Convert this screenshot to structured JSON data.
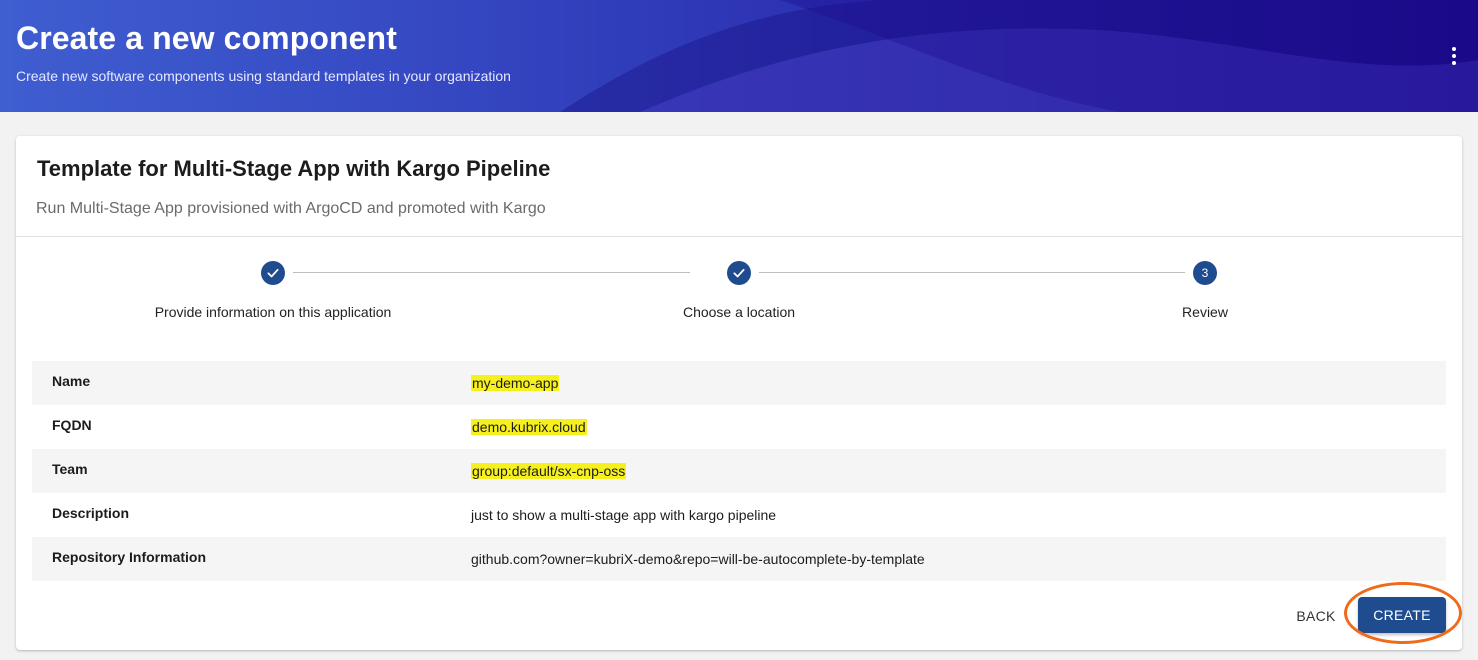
{
  "header": {
    "title": "Create a new component",
    "subtitle": "Create new software components using standard templates in your organization",
    "menu_icon": "kebab-menu-icon"
  },
  "template": {
    "title": "Template for Multi-Stage App with Kargo Pipeline",
    "subtitle": "Run Multi-Stage App provisioned with ArgoCD and promoted with Kargo"
  },
  "stepper": {
    "steps": [
      {
        "label": "Provide information on this application",
        "status": "completed",
        "icon": "check-icon"
      },
      {
        "label": "Choose a location",
        "status": "completed",
        "icon": "check-icon"
      },
      {
        "label": "Review",
        "status": "active",
        "number": "3"
      }
    ]
  },
  "review": {
    "rows": [
      {
        "key": "Name",
        "value": "my-demo-app",
        "highlighted": true
      },
      {
        "key": "FQDN",
        "value": "demo.kubrix.cloud",
        "highlighted": true
      },
      {
        "key": "Team",
        "value": "group:default/sx-cnp-oss",
        "highlighted": true
      },
      {
        "key": "Description",
        "value": "just to show a multi-stage app with kargo pipeline",
        "highlighted": false
      },
      {
        "key": "Repository Information",
        "value": "github.com?owner=kubriX-demo&repo=will-be-autocomplete-by-template",
        "highlighted": false
      }
    ]
  },
  "actions": {
    "back_label": "BACK",
    "create_label": "CREATE"
  },
  "colors": {
    "primary": "#1f4b8f",
    "highlight": "#f6f01e",
    "annotation": "#f06a1a"
  }
}
